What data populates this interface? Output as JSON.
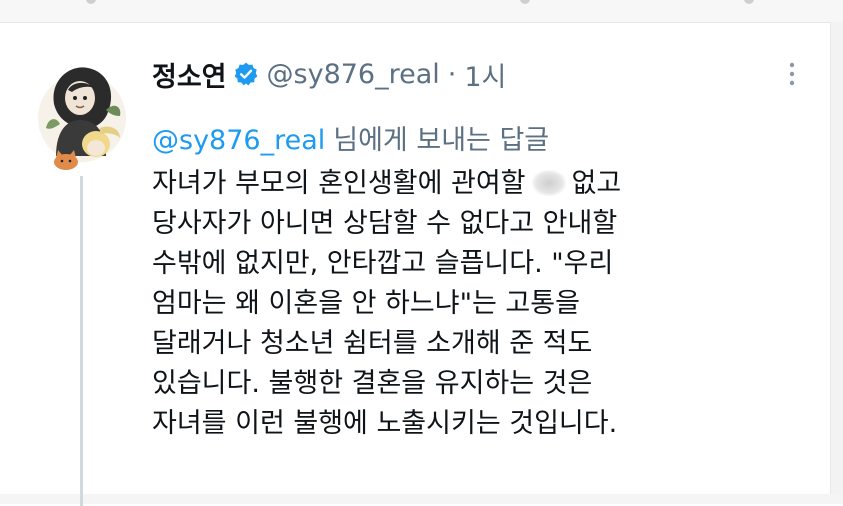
{
  "tweet": {
    "display_name": "정소연",
    "handle": "@sy876_real",
    "separator": "·",
    "time": "1시",
    "reply_to": {
      "mention": "@sy876_real",
      "text": "님에게 보내는 답글"
    },
    "body": {
      "line1_before": "자녀가 부모의 혼인생활에 관여할",
      "line1_after": "없고",
      "lines": [
        "당사자가 아니면 상담할 수 없다고 안내할",
        "수밖에 없지만, 안타깝고 슬픕니다. \"우리",
        "엄마는 왜 이혼을 안 하느냐\"는 고통을",
        "달래거나 청소년 쉼터를 소개해 준 적도",
        "있습니다. 불행한 결혼을 유지하는 것은",
        "자녀를 이런 불행에 노출시키는 것입니다."
      ]
    }
  },
  "icons": {
    "verified": "verified-badge-icon",
    "more": "more-options-icon",
    "avatar": "avatar-illustration"
  },
  "colors": {
    "link": "#1d9bf0",
    "secondary_text": "#5b7083",
    "primary_text": "#0f1419",
    "thread_line": "#cfd9de"
  }
}
